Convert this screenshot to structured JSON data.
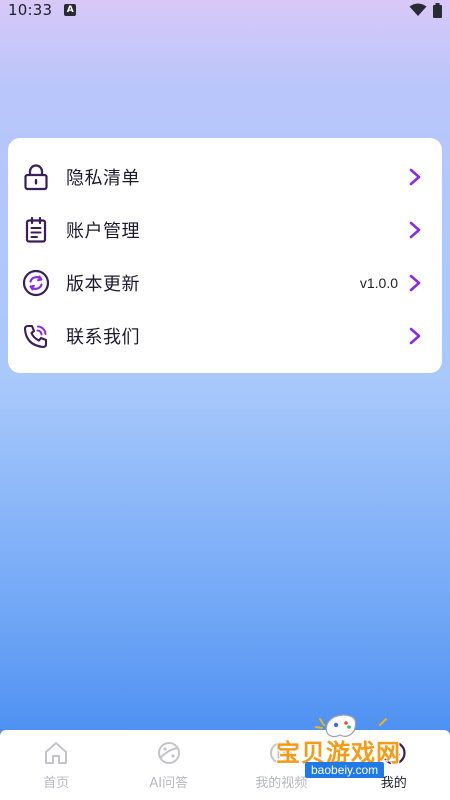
{
  "status": {
    "time": "10:33"
  },
  "menu": {
    "items": [
      {
        "label": "隐私清单",
        "icon": "lock-icon"
      },
      {
        "label": "账户管理",
        "icon": "clipboard-icon"
      },
      {
        "label": "版本更新",
        "icon": "refresh-icon",
        "value": "v1.0.0"
      },
      {
        "label": "联系我们",
        "icon": "phone-icon"
      }
    ]
  },
  "tabs": [
    {
      "label": "首页",
      "icon": "home-icon"
    },
    {
      "label": "AI问答",
      "icon": "planet-icon"
    },
    {
      "label": "我的视频",
      "icon": "video-icon"
    },
    {
      "label": "我的",
      "icon": "smile-icon",
      "active": true
    }
  ],
  "watermark": {
    "text": "宝贝游戏网",
    "url": "baobeiy.com"
  },
  "colors": {
    "accent": "#8a2be2",
    "icon_dark": "#3b1d5a"
  }
}
